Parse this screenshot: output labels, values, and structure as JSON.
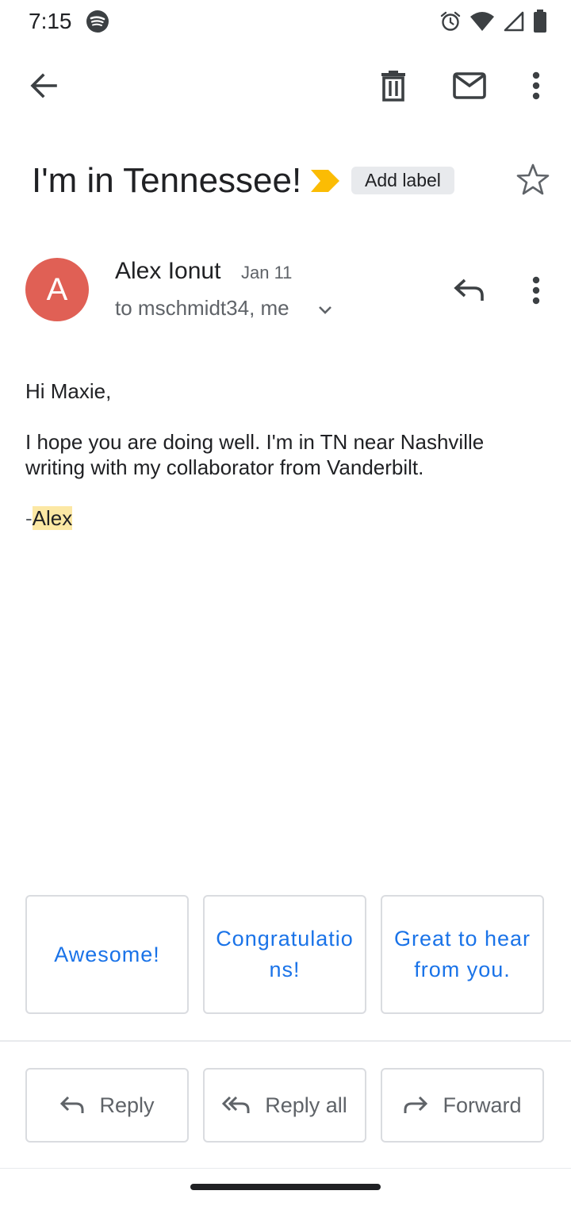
{
  "status_bar": {
    "time": "7:15"
  },
  "toolbar": {
    "back": "back-arrow-icon",
    "delete": "trash-icon",
    "mark_unread": "mail-icon",
    "more": "more-vert-icon"
  },
  "email": {
    "subject": "I'm in Tennessee!",
    "add_label": "Add label",
    "sender": {
      "initial": "A",
      "name": "Alex Ionut",
      "date": "Jan 11",
      "recipients": "to mschmidt34, me"
    },
    "body": {
      "greeting": "Hi Maxie,",
      "line1": "I hope you are doing well. I'm in TN near Nashville",
      "line2": "writing with my collaborator from Vanderbilt.",
      "sig_dash": "-",
      "sig_name": "Alex"
    }
  },
  "smart_replies": [
    "Awesome!",
    "Congratulations!",
    "Great to hear from you."
  ],
  "actions": {
    "reply": "Reply",
    "reply_all": "Reply all",
    "forward": "Forward"
  },
  "colors": {
    "accent": "#1a73e8",
    "avatar": "#e06055",
    "importance": "#fbbc04",
    "highlight": "#fce8a4"
  }
}
